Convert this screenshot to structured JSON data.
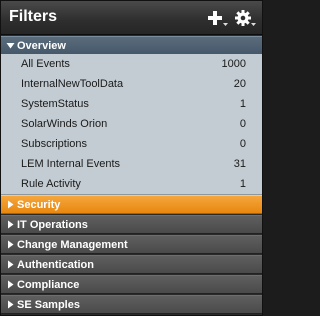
{
  "panel": {
    "title": "Filters",
    "add_icon": "plus-with-dropdown-icon",
    "settings_icon": "gear-with-dropdown-icon"
  },
  "colors": {
    "title_bar": "#2e2e2e",
    "expanded_header": "#4f6173",
    "item_background": "#c3ccd2",
    "selected_header": "#ee9222",
    "collapsed_header": "#555555"
  },
  "overview": {
    "label": "Overview",
    "state": "expanded",
    "items": [
      {
        "name": "All Events",
        "count": "1000"
      },
      {
        "name": "InternalNewToolData",
        "count": "20"
      },
      {
        "name": "SystemStatus",
        "count": "1"
      },
      {
        "name": "SolarWinds Orion",
        "count": "0"
      },
      {
        "name": "Subscriptions",
        "count": "0"
      },
      {
        "name": "LEM Internal Events",
        "count": "31"
      },
      {
        "name": "Rule Activity",
        "count": "1"
      }
    ]
  },
  "groups": [
    {
      "label": "Security",
      "state": "selected"
    },
    {
      "label": "IT Operations",
      "state": "collapsed"
    },
    {
      "label": "Change Management",
      "state": "collapsed"
    },
    {
      "label": "Authentication",
      "state": "collapsed"
    },
    {
      "label": "Compliance",
      "state": "collapsed"
    },
    {
      "label": "SE Samples",
      "state": "collapsed"
    }
  ]
}
